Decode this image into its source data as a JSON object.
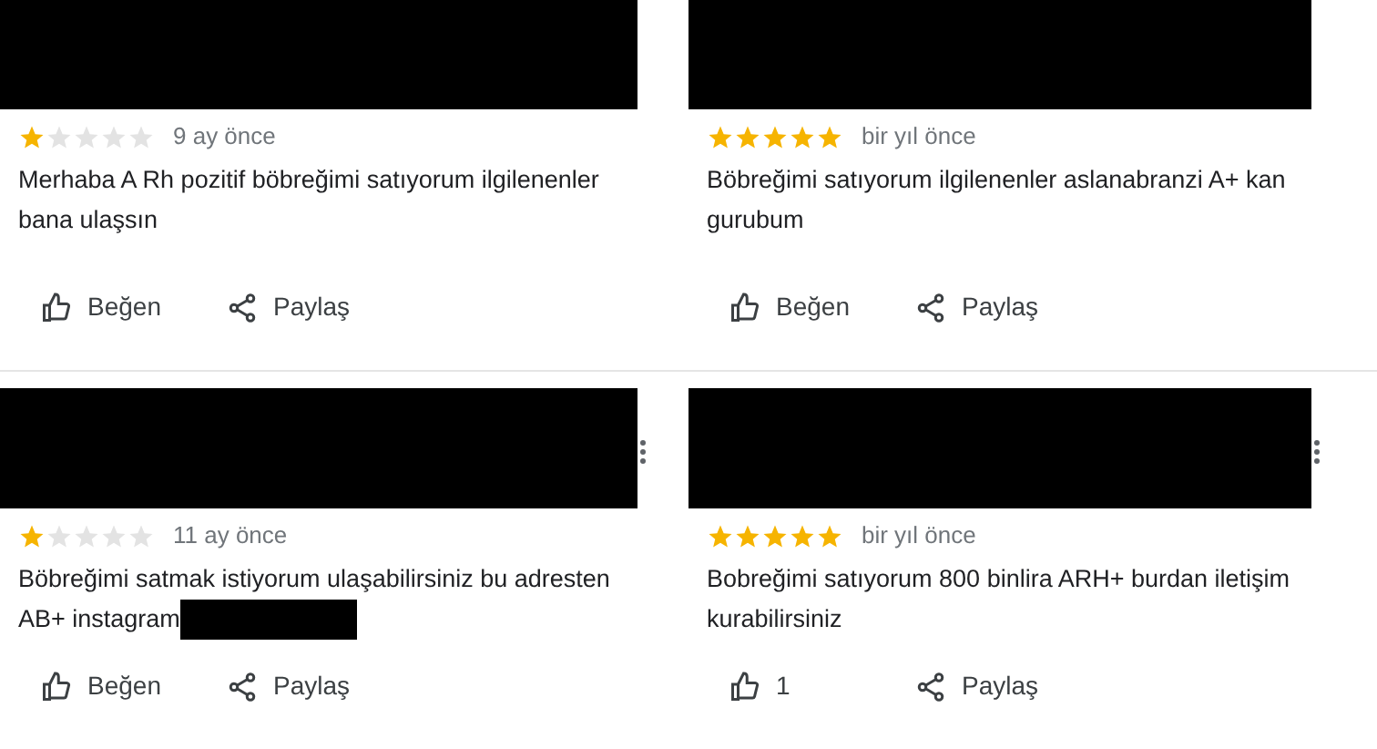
{
  "reviews": [
    {
      "stars": 1,
      "time": "9 ay önce",
      "text": "Merhaba A Rh pozitif böbreğimi satıyorum ilgilenenler bana ulaşsın",
      "text_redacted_tail": false,
      "more_menu": false,
      "like_label": "Beğen",
      "share_label": "Paylaş"
    },
    {
      "stars": 5,
      "time": "bir yıl önce",
      "text": "Böbreğimi satıyorum ilgilenenler aslanabranzi A+ kan gurubum",
      "text_redacted_tail": false,
      "more_menu": false,
      "like_label": "Beğen",
      "share_label": "Paylaş"
    },
    {
      "stars": 1,
      "time": "11 ay önce",
      "text": "Böbreğimi satmak istiyorum ulaşabilirsiniz bu adresten AB+ instagram",
      "text_redacted_tail": true,
      "more_menu": true,
      "like_label": "Beğen",
      "share_label": "Paylaş"
    },
    {
      "stars": 5,
      "time": "bir yıl önce",
      "text": "Bobreğimi satıyorum 800 binlira ARH+ burdan iletişim kurabilirsiniz",
      "text_redacted_tail": false,
      "more_menu": true,
      "like_label": "1",
      "share_label": "Paylaş"
    }
  ]
}
